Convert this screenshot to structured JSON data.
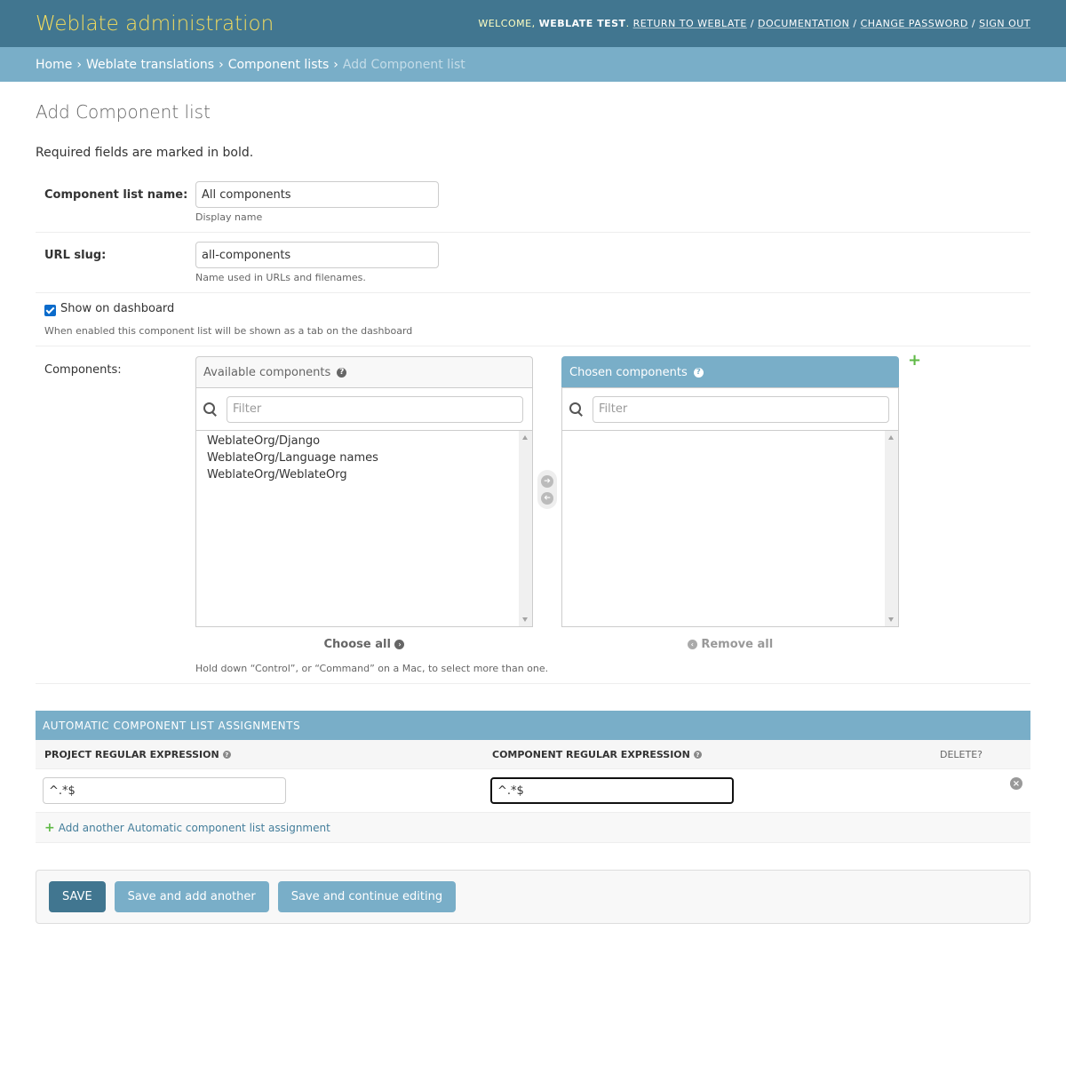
{
  "header": {
    "brand": "Weblate administration",
    "welcome": "WELCOME,",
    "username": "WEBLATE TEST",
    "links": [
      "RETURN TO WEBLATE",
      "DOCUMENTATION",
      "CHANGE PASSWORD",
      "SIGN OUT"
    ],
    "separator": "/"
  },
  "breadcrumbs": {
    "items": [
      "Home",
      "Weblate translations",
      "Component lists"
    ],
    "current": "Add Component list",
    "arrow": "›"
  },
  "page": {
    "title": "Add Component list",
    "required_note": "Required fields are marked in bold."
  },
  "form": {
    "name": {
      "label": "Component list name:",
      "value": "All components",
      "help": "Display name"
    },
    "slug": {
      "label": "URL slug:",
      "value": "all-components",
      "help": "Name used in URLs and filenames."
    },
    "show_dashboard": {
      "label": "Show on dashboard",
      "checked": true,
      "help": "When enabled this component list will be shown as a tab on the dashboard"
    },
    "components": {
      "label": "Components:",
      "available_title": "Available components",
      "chosen_title": "Chosen components",
      "filter_placeholder": "Filter",
      "available": [
        "WeblateOrg/Django",
        "WeblateOrg/Language names",
        "WeblateOrg/WeblateOrg"
      ],
      "chosen": [],
      "choose_all": "Choose all",
      "remove_all": "Remove all",
      "help": "Hold down “Control”, or “Command” on a Mac, to select more than one."
    }
  },
  "inline": {
    "title": "AUTOMATIC COMPONENT LIST ASSIGNMENTS",
    "col_project": "PROJECT REGULAR EXPRESSION",
    "col_component": "COMPONENT REGULAR EXPRESSION",
    "col_delete": "DELETE?",
    "rows": [
      {
        "project": "^.*$",
        "component": "^.*$"
      }
    ],
    "add_another": "Add another Automatic component list assignment"
  },
  "submit": {
    "save": "SAVE",
    "save_add": "Save and add another",
    "save_continue": "Save and continue editing"
  },
  "colors": {
    "header": "#417690",
    "accent": "#79aec8",
    "brand": "#f5dd5d",
    "add": "#5fb946"
  }
}
